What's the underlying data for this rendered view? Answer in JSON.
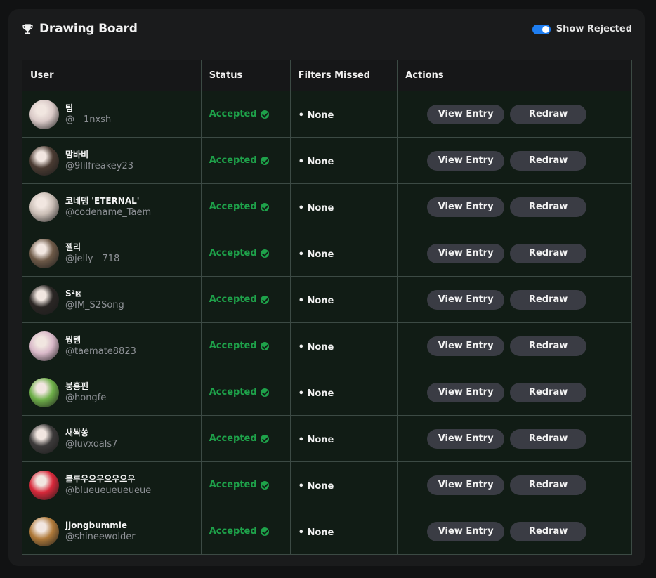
{
  "header": {
    "title": "Drawing Board",
    "icon": "trophy-icon",
    "toggle": {
      "label": "Show Rejected",
      "checked": true,
      "color": "#1e7ef2"
    }
  },
  "table": {
    "columns": [
      "User",
      "Status",
      "Filters Missed",
      "Actions"
    ],
    "action_labels": {
      "view": "View Entry",
      "redraw": "Redraw"
    },
    "rows": [
      {
        "name": "팀",
        "handle": "@__1nxsh__",
        "status": "Accepted",
        "filters": "• None",
        "avatar_color": "#d9c9c7"
      },
      {
        "name": "맘바비",
        "handle": "@9lilfreakey23",
        "status": "Accepted",
        "filters": "• None",
        "avatar_color": "#4a3b32"
      },
      {
        "name": "코네템 'ETERNAL'",
        "handle": "@codename_Taem",
        "status": "Accepted",
        "filters": "• None",
        "avatar_color": "#c9bdb5"
      },
      {
        "name": "젤리",
        "handle": "@jelly__718",
        "status": "Accepted",
        "filters": "• None",
        "avatar_color": "#6e5a48"
      },
      {
        "name": "S²⊠",
        "handle": "@IM_S2Song",
        "status": "Accepted",
        "filters": "• None",
        "avatar_color": "#2a2624"
      },
      {
        "name": "뭥템",
        "handle": "@taemate8823",
        "status": "Accepted",
        "filters": "• None",
        "avatar_color": "#d8b8c8"
      },
      {
        "name": "붕홍핀",
        "handle": "@hongfe__",
        "status": "Accepted",
        "filters": "• None",
        "avatar_color": "#6fb04a"
      },
      {
        "name": "새싹쏭",
        "handle": "@luvxoals7",
        "status": "Accepted",
        "filters": "• None",
        "avatar_color": "#3c3a3a"
      },
      {
        "name": "블루우으우으우으우",
        "handle": "@blueueueueueue",
        "status": "Accepted",
        "filters": "• None",
        "avatar_color": "#d8283a"
      },
      {
        "name": "jjongbummie",
        "handle": "@shineewolder",
        "status": "Accepted",
        "filters": "• None",
        "avatar_color": "#b07a3a"
      }
    ]
  },
  "colors": {
    "accepted": "#1ea24a",
    "toggle_on": "#1e7ef2",
    "button_bg": "#3a3c44",
    "row_bg": "#111c15"
  }
}
